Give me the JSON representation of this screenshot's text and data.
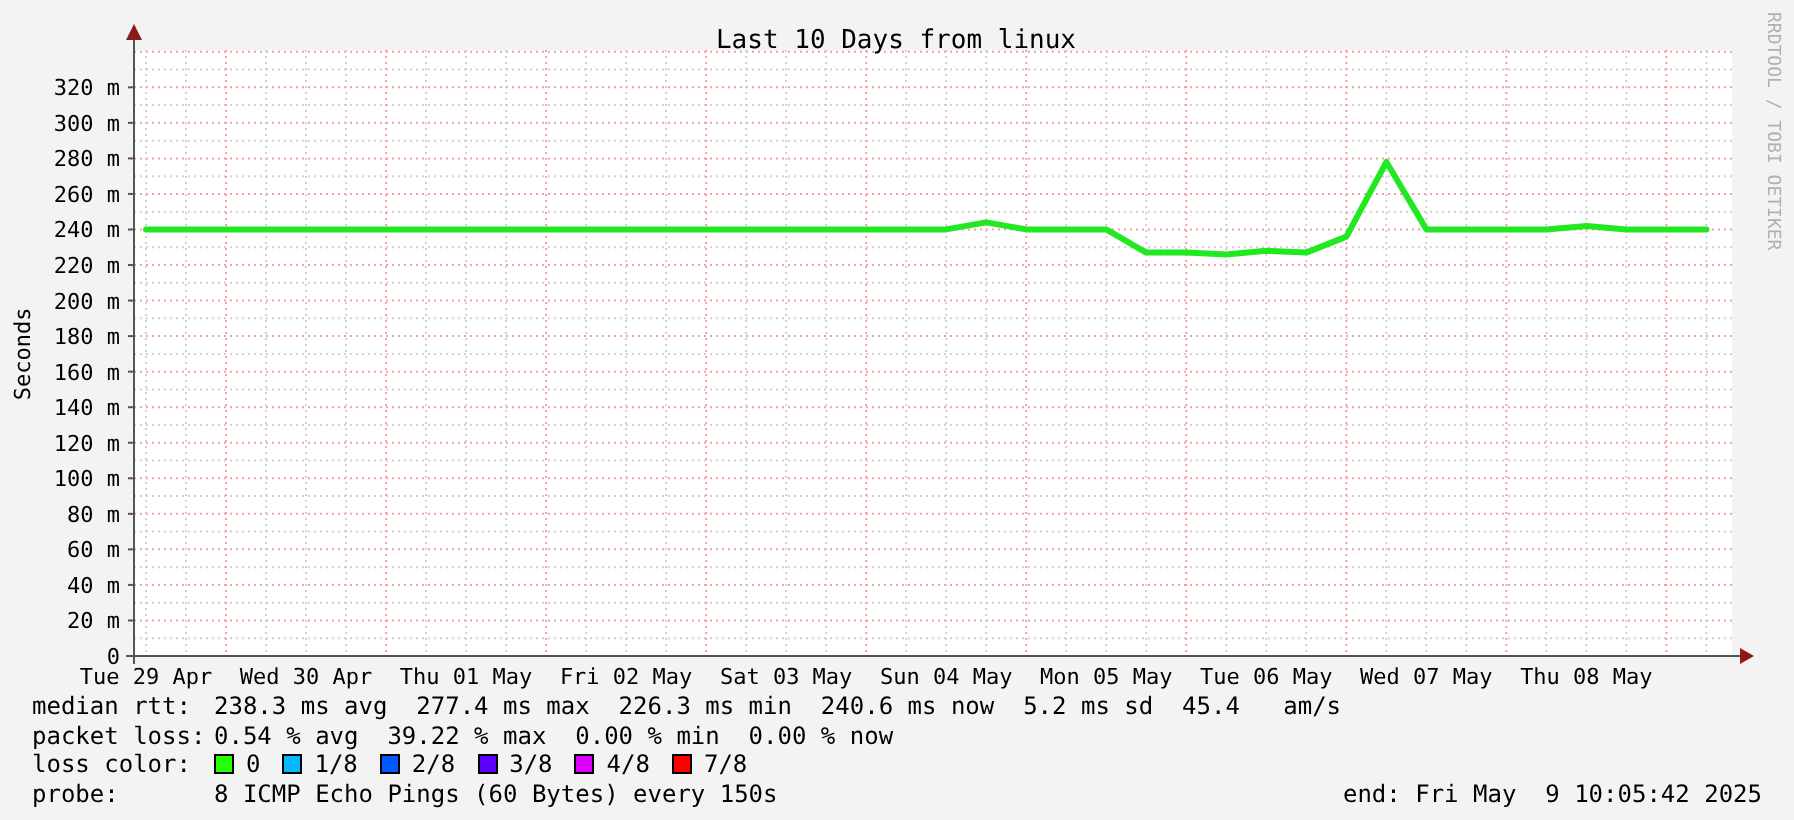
{
  "watermark_side": "RRDTOOL / TOBI OETIKER",
  "graph": {
    "chart_data": {
      "type": "line",
      "title": "Last 10 Days from linux",
      "ylabel": "Seconds",
      "categories": [
        "Tue 29 Apr",
        null,
        null,
        null,
        "Wed 30 Apr",
        null,
        null,
        null,
        "Thu 01 May",
        null,
        null,
        null,
        "Fri 02 May",
        null,
        null,
        null,
        "Sat 03 May",
        null,
        null,
        null,
        "Sun 04 May",
        null,
        null,
        null,
        "Mon 05 May",
        null,
        null,
        null,
        "Tue 06 May",
        null,
        null,
        null,
        "Wed 07 May",
        null,
        null,
        null,
        "Thu 08 May",
        null,
        null,
        null
      ],
      "series": [
        {
          "color": "#22e822",
          "values": [
            240,
            240,
            240,
            240,
            240,
            240,
            240,
            240,
            240,
            240,
            240,
            240,
            240,
            240,
            240,
            240,
            240,
            240,
            240,
            240,
            240,
            244,
            240,
            240,
            240,
            227,
            227,
            226,
            228,
            227,
            236,
            278,
            240,
            240,
            240,
            240,
            242,
            240,
            240,
            240
          ]
        }
      ],
      "grid": true,
      "ylim": [
        0,
        341
      ],
      "yticks": [
        {
          "value": 0,
          "label": "0"
        },
        {
          "value": 20,
          "label": "20 m"
        },
        {
          "value": 40,
          "label": "40 m"
        },
        {
          "value": 60,
          "label": "60 m"
        },
        {
          "value": 80,
          "label": "80 m"
        },
        {
          "value": 100,
          "label": "100 m"
        },
        {
          "value": 120,
          "label": "120 m"
        },
        {
          "value": 140,
          "label": "140 m"
        },
        {
          "value": 160,
          "label": "160 m"
        },
        {
          "value": 180,
          "label": "180 m"
        },
        {
          "value": 200,
          "label": "200 m"
        },
        {
          "value": 220,
          "label": "220 m"
        },
        {
          "value": 240,
          "label": "240 m"
        },
        {
          "value": 260,
          "label": "260 m"
        },
        {
          "value": 280,
          "label": "280 m"
        },
        {
          "value": 300,
          "label": "300 m"
        },
        {
          "value": 320,
          "label": "320 m"
        }
      ]
    }
  },
  "legend": [
    {
      "kind": "text",
      "label": "median rtt:",
      "value": "238.3 ms avg  277.4 ms max  226.3 ms min  240.6 ms now  5.2 ms sd  45.4   am/s"
    },
    {
      "kind": "text",
      "label": "packet loss:",
      "value": "0.54 % avg  39.22 % max  0.00 % min  0.00 % now"
    },
    {
      "kind": "colors",
      "label": "loss color:",
      "items": [
        {
          "label": "0",
          "color": "#26ff00"
        },
        {
          "label": "1/8",
          "color": "#00b8ff"
        },
        {
          "label": "2/8",
          "color": "#0059ff"
        },
        {
          "label": "3/8",
          "color": "#5e00ff"
        },
        {
          "label": "4/8",
          "color": "#dd00ff"
        },
        {
          "label": "7/8",
          "color": "#ff0000"
        }
      ]
    },
    {
      "kind": "text",
      "label": "probe:",
      "value": "8 ICMP Echo Pings (60 Bytes) every 150s",
      "end": "end: Fri May  9 10:05:42 2025"
    }
  ]
}
